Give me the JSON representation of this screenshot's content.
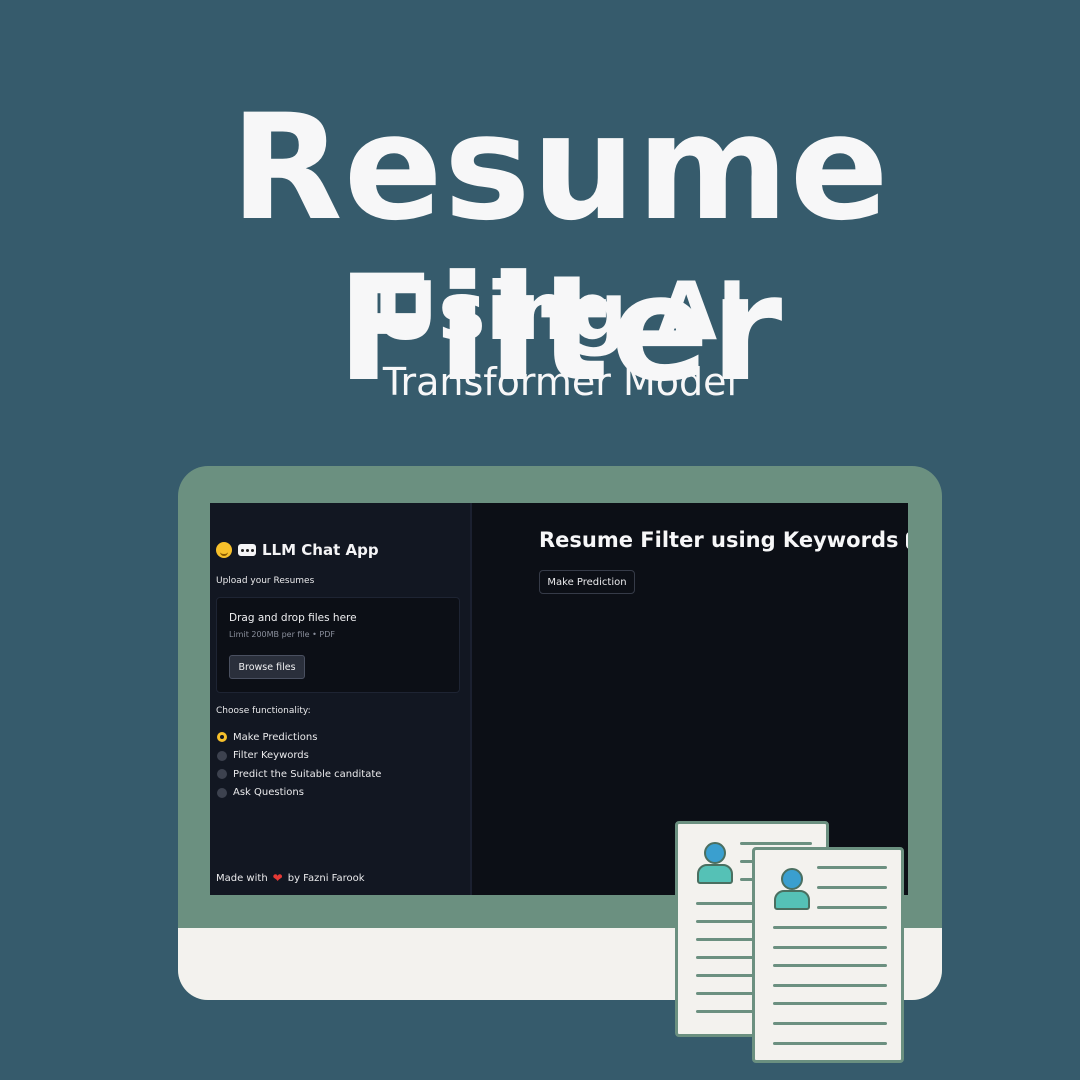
{
  "hero": {
    "title": "Resume Filter",
    "subtitle": "Using AI",
    "tagline": "Transformer Model"
  },
  "colors": {
    "background": "#365b6c",
    "monitor_frame": "#6b9080",
    "monitor_chin": "#f3f2ee",
    "accent_radio": "#f7c02b",
    "heart": "#e53935"
  },
  "app": {
    "sidebar": {
      "title": "LLM Chat App",
      "title_icons": [
        "hugging-face-emoji-icon",
        "speech-bubble-icon"
      ],
      "upload": {
        "label": "Upload your Resumes",
        "dropzone_text": "Drag and drop files here",
        "limit_text": "Limit 200MB per file • PDF",
        "browse_label": "Browse files"
      },
      "functionality": {
        "label": "Choose functionality:",
        "selected": "Make Predictions",
        "options": [
          "Make Predictions",
          "Filter Keywords",
          "Predict the Suitable canditate",
          "Ask Questions"
        ]
      },
      "footer": {
        "made_with": "Made with",
        "by": "by Fazni Farook"
      }
    },
    "main": {
      "title": "Resume Filter using Keywords",
      "predict_button": "Make Prediction"
    }
  }
}
